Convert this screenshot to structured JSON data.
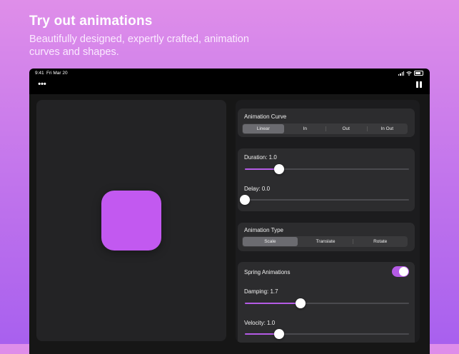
{
  "promo": {
    "title": "Try out animations",
    "subtitle": "Beautifully designed, expertly crafted, animation curves and shapes."
  },
  "status_bar": {
    "time": "9:41",
    "date": "Fri Mar 20"
  },
  "toolbar": {
    "more_icon": "more-horizontal-icon",
    "pause_icon": "pause-icon",
    "more_glyph": "•••"
  },
  "preview": {
    "shape_color": "#c259f0"
  },
  "controls": {
    "accent_color": "#b55be6",
    "animation_curve": {
      "label": "Animation Curve",
      "options": [
        "Linear",
        "In",
        "Out",
        "In Out"
      ],
      "selected": "Linear"
    },
    "duration": {
      "label": "Duration: 1.0",
      "value": 1.0,
      "fraction": 0.21
    },
    "delay": {
      "label": "Delay: 0.0",
      "value": 0.0,
      "fraction": 0.0
    },
    "animation_type": {
      "label": "Animation Type",
      "options": [
        "Scale",
        "Translate",
        "Rotate"
      ],
      "selected": "Scale"
    },
    "spring": {
      "label": "Spring Animations",
      "enabled": true,
      "damping": {
        "label": "Damping: 1.7",
        "value": 1.7,
        "fraction": 0.34
      },
      "velocity": {
        "label": "Velocity: 1.0",
        "value": 1.0,
        "fraction": 0.21
      }
    }
  }
}
